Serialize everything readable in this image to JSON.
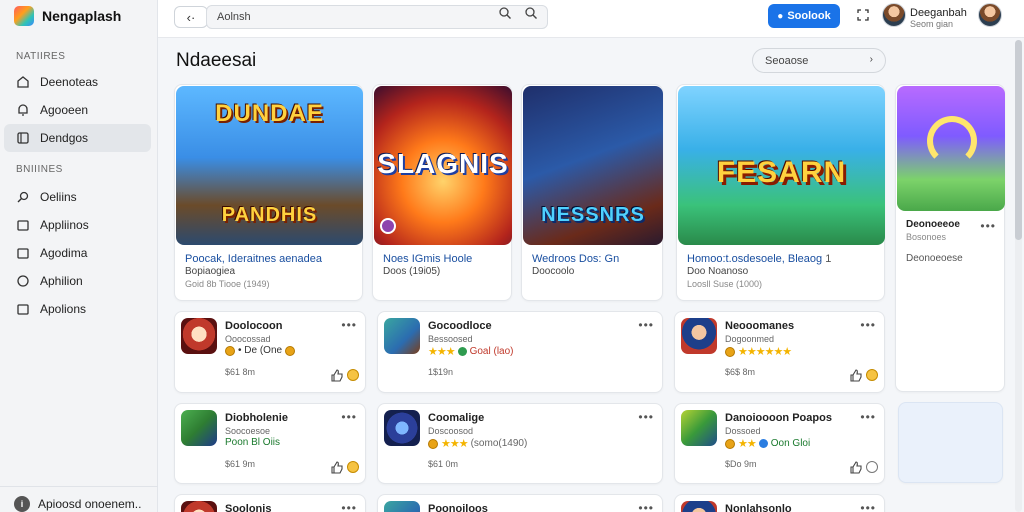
{
  "app": {
    "name": "Nengaplash"
  },
  "sidebar": {
    "section1": "NATIIRES",
    "section2": "BNIIINES",
    "items": [
      {
        "label": "Deenoteas",
        "icon": "home-icon"
      },
      {
        "label": "Agooeen",
        "icon": "bell-icon"
      },
      {
        "label": "Dendgos",
        "icon": "grid-icon"
      },
      {
        "label": "Oeliins",
        "icon": "search-icon"
      },
      {
        "label": "Appliinos",
        "icon": "window-icon"
      },
      {
        "label": "Agodima",
        "icon": "window-icon"
      },
      {
        "label": "Aphilion",
        "icon": "circle-icon"
      },
      {
        "label": "Apolions",
        "icon": "window-icon"
      }
    ],
    "footer": {
      "label": "Apioosd onoenem.."
    }
  },
  "topbar": {
    "search_placeholder": "Aolnsh",
    "primary_button": "Soolook",
    "user_name": "Deeganbah",
    "user_sub": "Seom gian"
  },
  "main": {
    "title": "Ndaeesai",
    "sort_label": "Seoaose"
  },
  "heroes": [
    {
      "art_word": "DUNDAE",
      "art_word2": "PANDHIS",
      "line1": "Poocak, Ideraitnes aenadea",
      "line2": "Bopiaogiea",
      "line3": "Goid 8b Tiooe (1949)"
    },
    {
      "art_word": "SLAGNIS",
      "line1": "Noes IGmis Hoole",
      "line2": "Doos (19i05)"
    },
    {
      "art_word": "NESSNRS",
      "line1": "Wedroos Dos: Gn",
      "line2": "Doocoolo"
    },
    {
      "art_word": "FESARN",
      "line1": "Homoo:t.osdesoele, Bleaog",
      "line1b": "1",
      "line2": "Doo Noanoso",
      "line3": "Loosll Suse (1000)"
    },
    {
      "art_word": "",
      "line1": "Deonoeeoe",
      "line2": "Bosonoes",
      "line3": "Deonoeoese"
    }
  ],
  "apps": [
    {
      "title": "Doolocoon",
      "sub": "Ooocossad",
      "rating": "• De (One",
      "meta": "$61 8m",
      "palette": "red"
    },
    {
      "title": "Gocoodloce",
      "sub": "Bessoosed",
      "rating": "Goal (lao)",
      "meta": "1$19n",
      "palette": "teal"
    },
    {
      "title": "Neooomanes",
      "sub": "Dogoonmed",
      "rating": "",
      "meta": "$6$ 8m",
      "palette": "navy"
    },
    {
      "title": "Diobholenie",
      "sub": "Soocoesoe",
      "rating": "Poon  Bl Oiis",
      "meta": "$61 9m",
      "palette": "green"
    },
    {
      "title": "Coomalige",
      "sub": "Doscoosod",
      "rating": "(somo(1490)",
      "meta": "$61 0m",
      "palette": "blue"
    },
    {
      "title": "Danoioooon Poapos",
      "sub": "Dossoed",
      "rating": "Oon Gloi",
      "meta": "$Do 9m",
      "palette": "lime"
    },
    {
      "title": "Soolonis",
      "sub": "",
      "rating": "",
      "meta": "",
      "palette": "red"
    },
    {
      "title": "Poonoiloos",
      "sub": "",
      "rating": "",
      "meta": "",
      "palette": "teal"
    },
    {
      "title": "Nonlahsonlo",
      "sub": "",
      "rating": "",
      "meta": "",
      "palette": "navy"
    }
  ],
  "colors": {
    "accent": "#1a73e8",
    "star": "#f4b400"
  }
}
